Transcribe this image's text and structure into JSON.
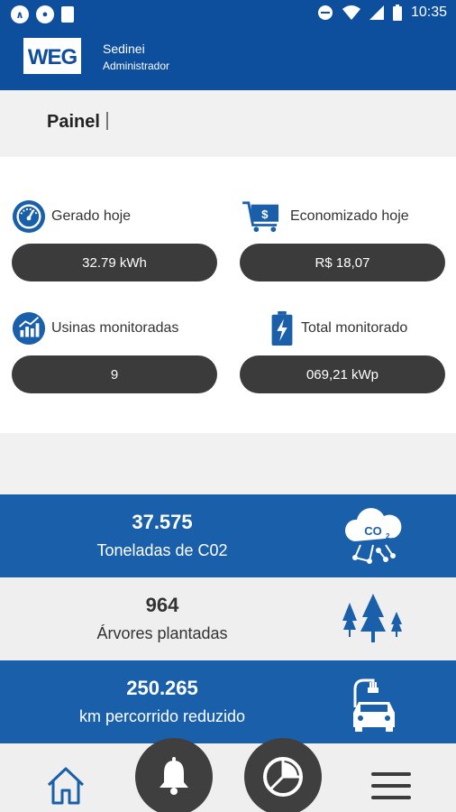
{
  "status_bar": {
    "time": "10:35"
  },
  "header": {
    "user_name": "Sedinei",
    "user_role": "Administrador",
    "logo_text": "WEG"
  },
  "page": {
    "title": "Painel"
  },
  "stats": [
    {
      "label": "Gerado hoje",
      "value": "32.79 kWh",
      "icon": "gauge-icon"
    },
    {
      "label": "Economizado hoje",
      "value": "R$ 18,07",
      "icon": "cart-dollar-icon"
    },
    {
      "label": "Usinas monitoradas",
      "value": "9",
      "icon": "chart-growth-icon"
    },
    {
      "label": "Total monitorado",
      "value": "069,21 kWp",
      "icon": "battery-bolt-icon"
    }
  ],
  "eco": [
    {
      "value": "37.575",
      "label": "Toneladas de C02",
      "icon": "co2-cloud-icon"
    },
    {
      "value": "964",
      "label": "Árvores plantadas",
      "icon": "trees-icon"
    },
    {
      "value": "250.265",
      "label": "km percorrido reduzido",
      "icon": "electric-car-icon"
    }
  ],
  "colors": {
    "primary": "#0d4f9c",
    "eco_blue": "#1a5faa",
    "pill": "#3b3b3b"
  },
  "nav": [
    "home-icon",
    "bell-icon",
    "pie-chart-icon",
    "menu-icon"
  ]
}
